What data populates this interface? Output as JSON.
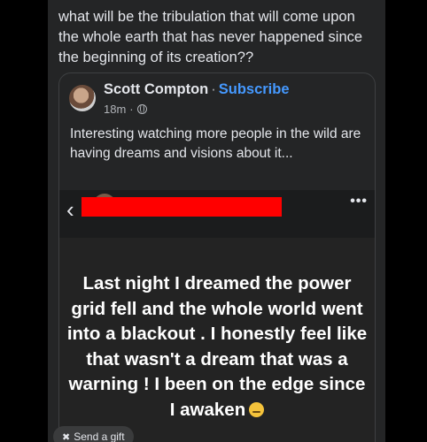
{
  "post": {
    "text": "what will be the tribulation that will come upon the whole earth that has never happened since the beginning of its creation??"
  },
  "shared": {
    "author": "Scott Compton",
    "separator": "·",
    "subscribe": "Subscribe",
    "time": "18m",
    "time_separator": "·",
    "privacy_icon": "globe-icon",
    "text": "Interesting watching more people in the wild are having dreams and visions about it..."
  },
  "story": {
    "back_icon": "‹",
    "more_icon": "•••",
    "text": "Last night I dreamed the power grid fell and the whole world went into a blackout . I honestly feel like that wasn't a dream that was a warning ! I been on the edge since I awaken",
    "emoji": "sad-face-emoji",
    "redaction_color": "#ff0000"
  },
  "actions": {
    "send_gift": "Send a gift",
    "gift_icon": "gift-icon"
  },
  "colors": {
    "background": "#242526",
    "accent": "#4599ff",
    "text": "#e4e6eb"
  }
}
